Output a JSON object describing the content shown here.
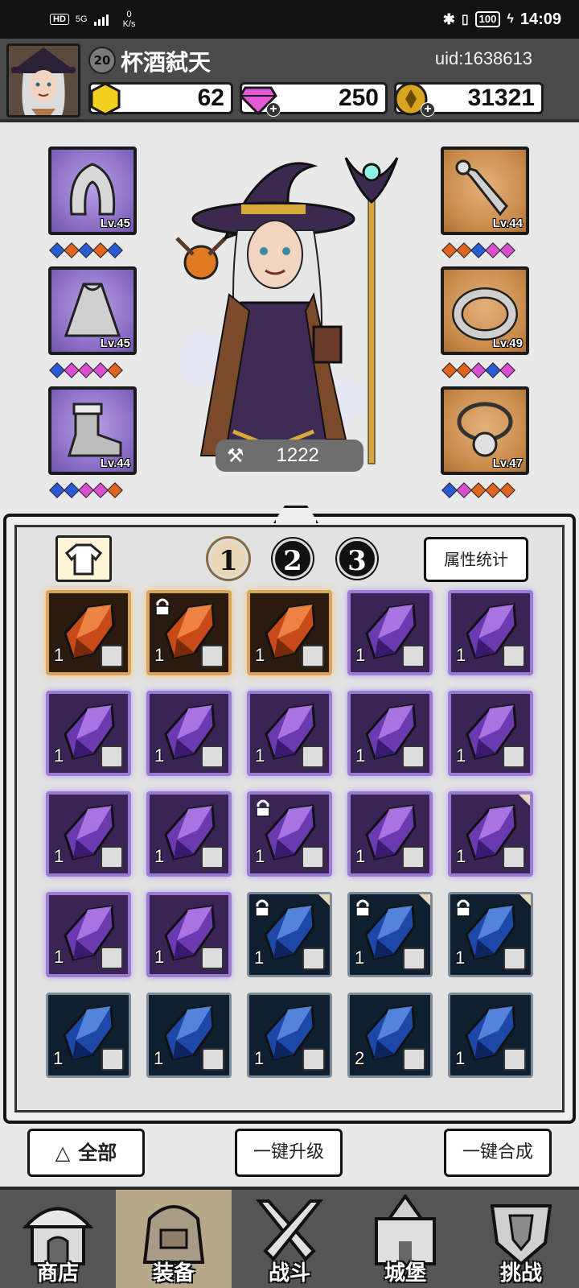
{
  "status_bar": {
    "hd_label": "HD",
    "signal": "5G",
    "speed_value": "0",
    "speed_unit": "K/s",
    "battery": "100",
    "time": "14:09"
  },
  "header": {
    "level": "20",
    "player_name": "杯酒弑天",
    "uid": "uid:1638613",
    "currencies": {
      "gold": "62",
      "diamond": "250",
      "coin": "31321"
    }
  },
  "character": {
    "power": "1222",
    "left_slots": [
      {
        "name": "hood",
        "level": "Lv.45",
        "gems": [
          "#2a5bd7",
          "#e0641e",
          "#2a5bd7",
          "#e0641e",
          "#2a5bd7"
        ]
      },
      {
        "name": "cloak",
        "level": "Lv.45",
        "gems": [
          "#2a5bd7",
          "#d94fd0",
          "#d94fd0",
          "#d94fd0",
          "#e0641e"
        ]
      },
      {
        "name": "boots",
        "level": "Lv.44",
        "gems": [
          "#2a5bd7",
          "#2a5bd7",
          "#d94fd0",
          "#d94fd0",
          "#e0641e"
        ]
      }
    ],
    "right_slots": [
      {
        "name": "bone-weapon",
        "level": "Lv.44",
        "gems": [
          "#e0641e",
          "#e0641e",
          "#2a5bd7",
          "#d94fd0",
          "#d94fd0"
        ]
      },
      {
        "name": "ring",
        "level": "Lv.49",
        "gems": [
          "#e0641e",
          "#e0641e",
          "#d94fd0",
          "#2a5bd7",
          "#d94fd0"
        ]
      },
      {
        "name": "necklace",
        "level": "Lv.47",
        "gems": [
          "#2a5bd7",
          "#d94fd0",
          "#e0641e",
          "#e0641e",
          "#e0641e"
        ]
      }
    ]
  },
  "inventory": {
    "tabs": [
      "1",
      "2",
      "3"
    ],
    "active_tab": "1",
    "stats_button": "属性统计",
    "items": [
      {
        "rarity": "orange",
        "count": "1",
        "type": "boot",
        "locked": false,
        "corner": false
      },
      {
        "rarity": "orange",
        "count": "1",
        "type": "boot",
        "locked": true,
        "corner": false
      },
      {
        "rarity": "orange",
        "count": "1",
        "type": "ring",
        "locked": false,
        "corner": false
      },
      {
        "rarity": "purple",
        "count": "1",
        "type": "hood",
        "locked": false,
        "corner": false
      },
      {
        "rarity": "purple",
        "count": "1",
        "type": "cloak",
        "locked": false,
        "corner": false
      },
      {
        "rarity": "purple",
        "count": "1",
        "type": "cloak",
        "locked": false,
        "corner": false
      },
      {
        "rarity": "purple",
        "count": "1",
        "type": "boot",
        "locked": false,
        "corner": false
      },
      {
        "rarity": "purple",
        "count": "1",
        "type": "boot",
        "locked": false,
        "corner": false
      },
      {
        "rarity": "purple",
        "count": "1",
        "type": "weapon",
        "locked": false,
        "corner": false
      },
      {
        "rarity": "purple",
        "count": "1",
        "type": "weapon",
        "locked": false,
        "corner": false
      },
      {
        "rarity": "purple",
        "count": "1",
        "type": "weapon",
        "locked": false,
        "corner": false
      },
      {
        "rarity": "purple",
        "count": "1",
        "type": "ring",
        "locked": false,
        "corner": false
      },
      {
        "rarity": "purple",
        "count": "1",
        "type": "ring",
        "locked": true,
        "corner": false
      },
      {
        "rarity": "purple",
        "count": "1",
        "type": "ring",
        "locked": false,
        "corner": false
      },
      {
        "rarity": "purple",
        "count": "1",
        "type": "necklace",
        "locked": false,
        "corner": true
      },
      {
        "rarity": "purple",
        "count": "1",
        "type": "necklace",
        "locked": false,
        "corner": false
      },
      {
        "rarity": "purple",
        "count": "1",
        "type": "necklace",
        "locked": false,
        "corner": false
      },
      {
        "rarity": "blue",
        "count": "1",
        "type": "hood",
        "locked": true,
        "corner": true
      },
      {
        "rarity": "blue",
        "count": "1",
        "type": "hood",
        "locked": true,
        "corner": true
      },
      {
        "rarity": "blue",
        "count": "1",
        "type": "cloak",
        "locked": true,
        "corner": true
      },
      {
        "rarity": "blue",
        "count": "1",
        "type": "cloak",
        "locked": false,
        "corner": false
      },
      {
        "rarity": "blue",
        "count": "1",
        "type": "cloak",
        "locked": false,
        "corner": false
      },
      {
        "rarity": "blue",
        "count": "1",
        "type": "boot",
        "locked": false,
        "corner": false
      },
      {
        "rarity": "blue",
        "count": "2",
        "type": "boot",
        "locked": false,
        "corner": false
      },
      {
        "rarity": "blue",
        "count": "1",
        "type": "boot",
        "locked": false,
        "corner": false
      }
    ]
  },
  "actions": {
    "all": "全部",
    "upgrade_all": "一键升级",
    "merge_all": "一键合成"
  },
  "bottom_nav": [
    {
      "label": "商店",
      "icon": "shop-icon",
      "active": false
    },
    {
      "label": "装备",
      "icon": "equipment-bag-icon",
      "active": true
    },
    {
      "label": "战斗",
      "icon": "crossed-swords-icon",
      "active": false
    },
    {
      "label": "城堡",
      "icon": "castle-icon",
      "active": false
    },
    {
      "label": "挑战",
      "icon": "shield-challenge-icon",
      "active": false
    }
  ]
}
